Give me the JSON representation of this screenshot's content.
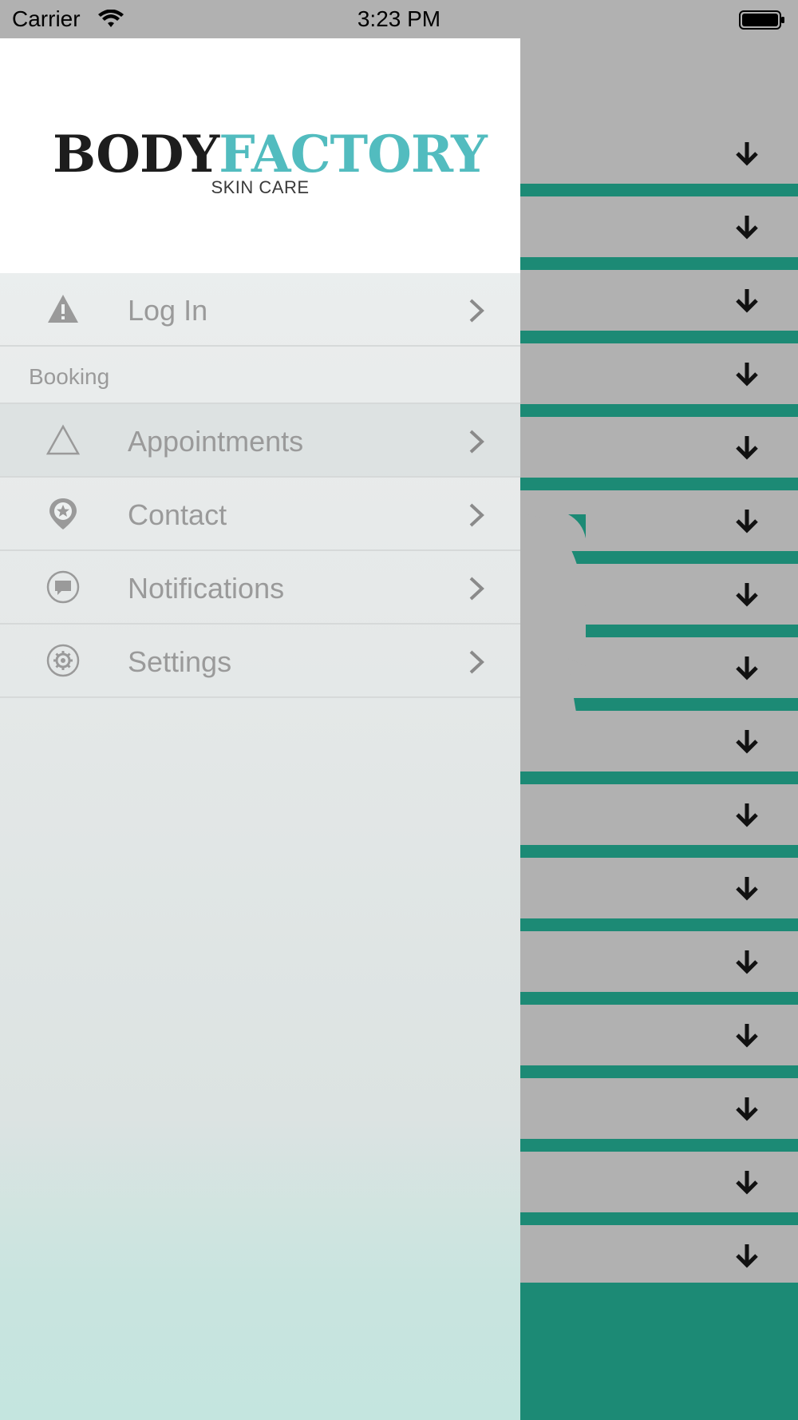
{
  "status_bar": {
    "carrier": "Carrier",
    "time": "3:23 PM"
  },
  "drawer": {
    "logo": {
      "body": "BODY",
      "factory": "FACTORY",
      "subtitle": "SKIN CARE"
    },
    "items": [
      {
        "label": "Log In",
        "icon": "warning-icon"
      },
      {
        "label": "Appointments",
        "icon": "triangle-icon"
      },
      {
        "label": "Contact",
        "icon": "location-star-icon"
      },
      {
        "label": "Notifications",
        "icon": "chat-bubble-icon"
      },
      {
        "label": "Settings",
        "icon": "gear-icon"
      }
    ],
    "section_booking": "Booking"
  },
  "colors": {
    "accent_teal": "#1c8a75",
    "logo_teal": "#52bcbf",
    "background_gray": "#b1b1b1",
    "menu_text": "#9a9a9a"
  }
}
